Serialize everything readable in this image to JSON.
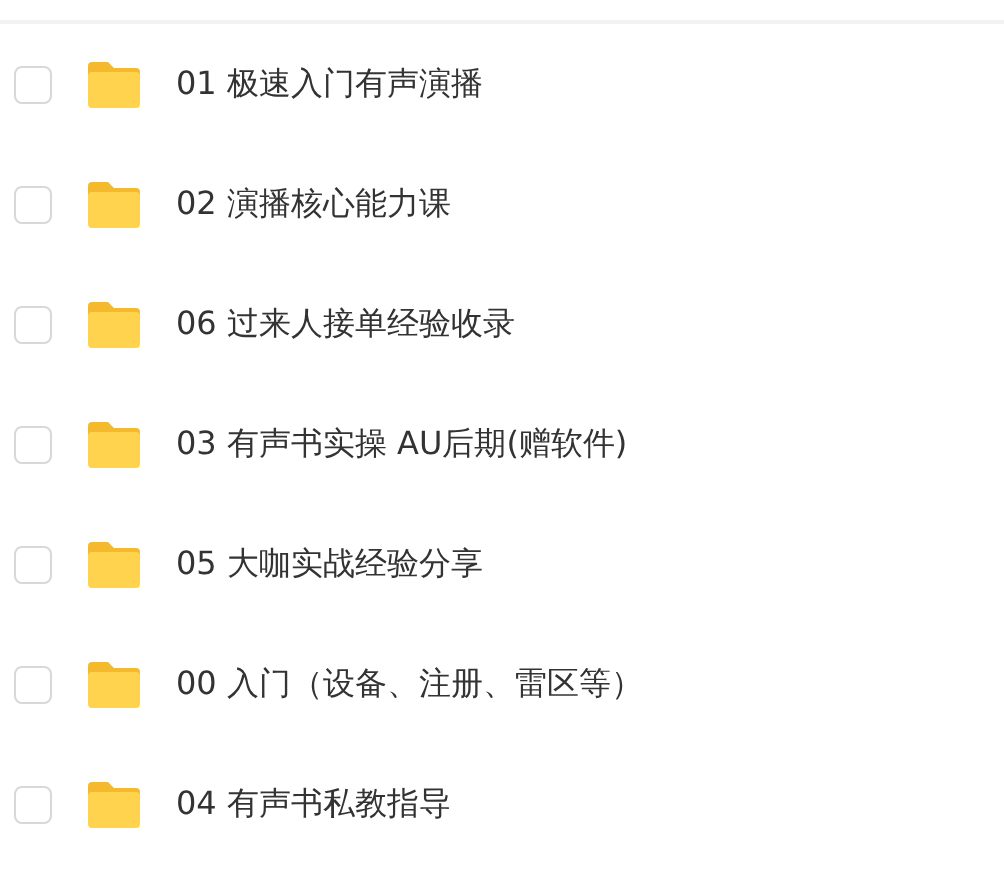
{
  "folders": [
    {
      "name": "01 极速入门有声演播",
      "checked": false
    },
    {
      "name": "02 演播核心能力课",
      "checked": false
    },
    {
      "name": "06 过来人接单经验收录",
      "checked": false
    },
    {
      "name": "03 有声书实操 AU后期(赠软件)",
      "checked": false
    },
    {
      "name": "05 大咖实战经验分享",
      "checked": false
    },
    {
      "name": "00 入门（设备、注册、雷区等）",
      "checked": false
    },
    {
      "name": "04 有声书私教指导",
      "checked": false
    }
  ]
}
